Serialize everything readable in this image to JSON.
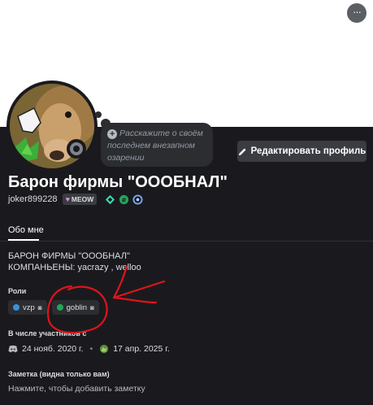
{
  "header": {
    "more_icon": "more-horizontal-icon",
    "more_label": "···"
  },
  "status_bubble": {
    "icon": "plus-circle-icon",
    "text": "Расскажите о своём последнем внезапном озарении"
  },
  "edit_profile": {
    "icon": "pencil-icon",
    "label": "Редактировать профиль"
  },
  "profile": {
    "display_name": "Барон фирмы \"ОООБНАЛ\"",
    "username": "joker899228",
    "tag": {
      "label": "MEOW",
      "icon": "heart-icon"
    },
    "badges": [
      "hypesquad-icon",
      "active-developer-icon",
      "nitro-icon"
    ]
  },
  "tabs": [
    {
      "label": "Обо мне",
      "active": true
    }
  ],
  "bio": {
    "line1": "БАРОН ФИРМЫ \"ОООБНАЛ\"",
    "line2": "КОМПАНЬЕНЫ: yacrazy , welloo"
  },
  "roles": {
    "title": "Роли",
    "items": [
      {
        "name": "vzp",
        "color": "#3b8fdc"
      },
      {
        "name": "goblin",
        "color": "#23a55a"
      }
    ]
  },
  "member_since": {
    "title": "В числе участников с",
    "discord_date": "24 нояб. 2020 г.",
    "server_date": "17 апр. 2025 г."
  },
  "note": {
    "title": "Заметка (видна только вам)",
    "placeholder": "Нажмите, чтобы добавить заметку"
  },
  "colors": {
    "background": "#1a1a1e",
    "banner": "#ffffff",
    "annotation": "#e0141c"
  }
}
